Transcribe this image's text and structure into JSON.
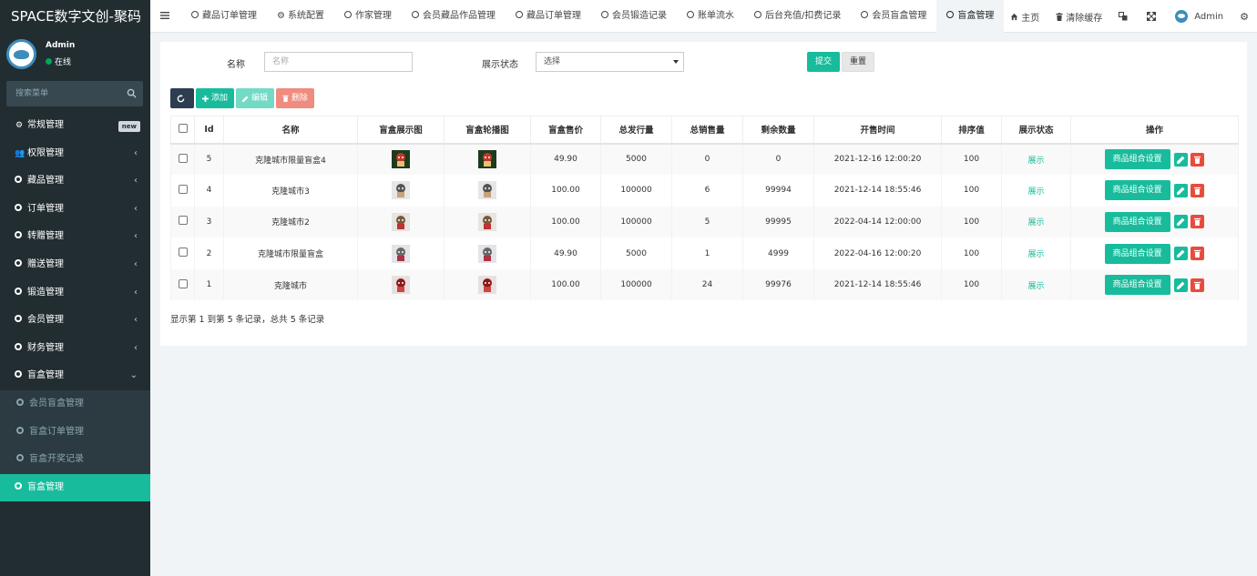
{
  "app": {
    "title": "SPACE数字文创-聚码"
  },
  "user": {
    "name": "Admin",
    "status": "在线"
  },
  "sidebar": {
    "search_placeholder": "搜索菜单",
    "items": [
      {
        "label": "常规管理",
        "badge": "new"
      },
      {
        "label": "权限管理"
      },
      {
        "label": "藏品管理"
      },
      {
        "label": "订单管理"
      },
      {
        "label": "转赠管理"
      },
      {
        "label": "赠送管理"
      },
      {
        "label": "锻造管理"
      },
      {
        "label": "会员管理"
      },
      {
        "label": "财务管理"
      },
      {
        "label": "盲盒管理"
      }
    ],
    "subitems": [
      {
        "label": "会员盲盒管理"
      },
      {
        "label": "盲盒订单管理"
      },
      {
        "label": "盲盒开奖记录"
      },
      {
        "label": "盲盒管理"
      }
    ]
  },
  "topnav": {
    "tabs": [
      {
        "label": "藏品订单管理"
      },
      {
        "label": "系统配置"
      },
      {
        "label": "作家管理"
      },
      {
        "label": "会员藏品作品管理"
      },
      {
        "label": "藏品订单管理"
      },
      {
        "label": "会员锻造记录"
      },
      {
        "label": "账单流水"
      },
      {
        "label": "后台充值/扣费记录"
      },
      {
        "label": "会员盲盒管理"
      },
      {
        "label": "盲盒管理"
      }
    ],
    "home": "主页",
    "clear_cache": "清除缓存",
    "admin": "Admin"
  },
  "form": {
    "name_label": "名称",
    "name_placeholder": "名称",
    "status_label": "展示状态",
    "status_value": "选择",
    "submit": "提交",
    "reset": "重置"
  },
  "toolbar": {
    "add": "添加",
    "edit": "编辑",
    "delete": "删除"
  },
  "table": {
    "headers": [
      "Id",
      "名称",
      "盲盒展示图",
      "盲盒轮播图",
      "盲盒售价",
      "总发行量",
      "总销售量",
      "剩余数量",
      "开售时间",
      "排序值",
      "展示状态",
      "操作"
    ],
    "rows": [
      {
        "id": "5",
        "name": "克隆城市限量盲盒4",
        "price": "49.90",
        "total": "5000",
        "sold": "0",
        "remain": "0",
        "time": "2021-12-16 12:00:20",
        "sort": "100",
        "status": "展示",
        "action": "商品组合设置"
      },
      {
        "id": "4",
        "name": "克隆城市3",
        "price": "100.00",
        "total": "100000",
        "sold": "6",
        "remain": "99994",
        "time": "2021-12-14 18:55:46",
        "sort": "100",
        "status": "展示",
        "action": "商品组合设置"
      },
      {
        "id": "3",
        "name": "克隆城市2",
        "price": "100.00",
        "total": "100000",
        "sold": "5",
        "remain": "99995",
        "time": "2022-04-14 12:00:00",
        "sort": "100",
        "status": "展示",
        "action": "商品组合设置"
      },
      {
        "id": "2",
        "name": "克隆城市限量盲盒",
        "price": "49.90",
        "total": "5000",
        "sold": "1",
        "remain": "4999",
        "time": "2022-04-16 12:00:20",
        "sort": "100",
        "status": "展示",
        "action": "商品组合设置"
      },
      {
        "id": "1",
        "name": "克隆城市",
        "price": "100.00",
        "total": "100000",
        "sold": "24",
        "remain": "99976",
        "time": "2021-12-14 18:55:46",
        "sort": "100",
        "status": "展示",
        "action": "商品组合设置"
      }
    ]
  },
  "footer": {
    "info": "显示第 1 到第 5 条记录，总共 5 条记录"
  }
}
